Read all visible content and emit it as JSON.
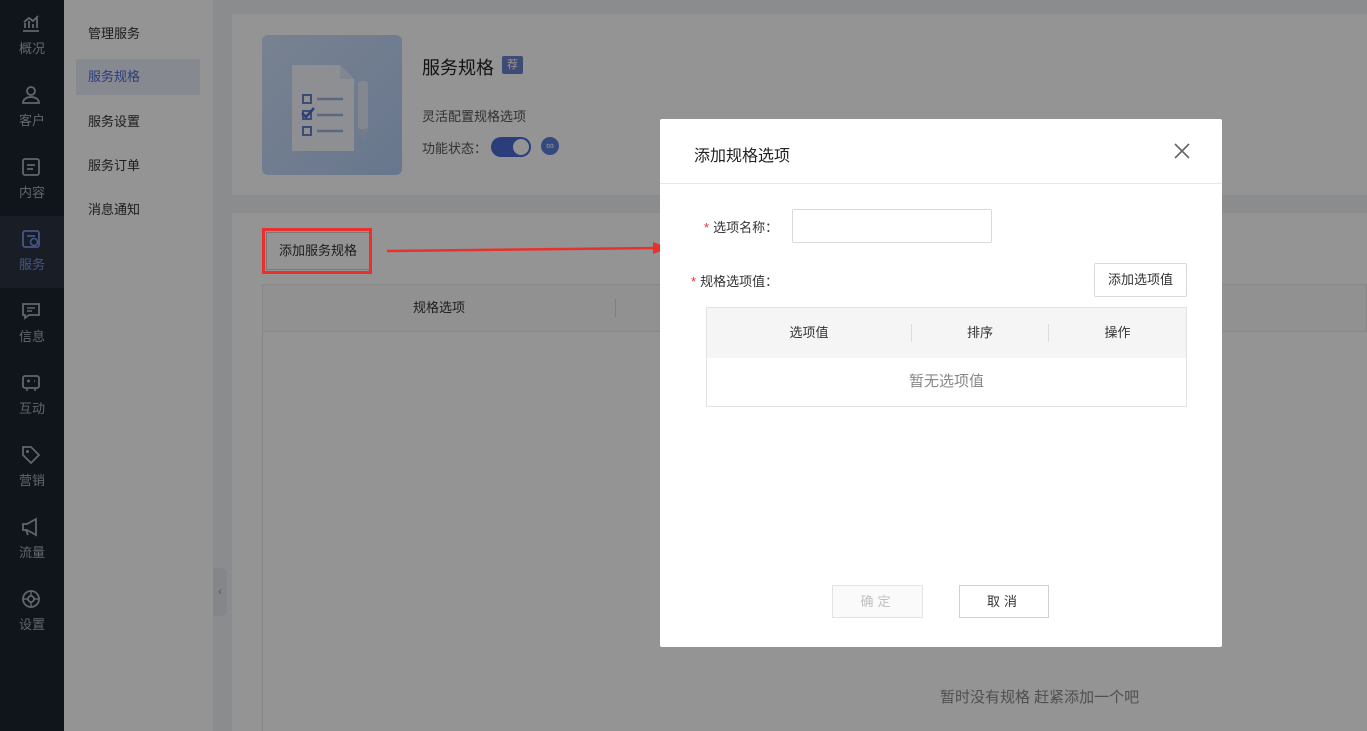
{
  "leftnav": {
    "items": [
      {
        "label": "概况",
        "icon": "chart-icon"
      },
      {
        "label": "客户",
        "icon": "user-icon"
      },
      {
        "label": "内容",
        "icon": "document-icon"
      },
      {
        "label": "服务",
        "icon": "service-icon",
        "active": true
      },
      {
        "label": "信息",
        "icon": "message-icon"
      },
      {
        "label": "互动",
        "icon": "interaction-icon"
      },
      {
        "label": "营销",
        "icon": "tag-icon"
      },
      {
        "label": "流量",
        "icon": "megaphone-icon"
      },
      {
        "label": "设置",
        "icon": "settings-icon"
      }
    ]
  },
  "subnav": {
    "items": [
      {
        "label": "管理服务"
      },
      {
        "label": "服务规格",
        "active": true
      },
      {
        "label": "服务设置"
      },
      {
        "label": "服务订单"
      },
      {
        "label": "消息通知"
      }
    ]
  },
  "service": {
    "title": "服务规格",
    "badge": "荐",
    "description": "灵活配置规格选项",
    "status_label": "功能状态：",
    "status_on": true
  },
  "main": {
    "add_spec_button": "添加服务规格",
    "table_headers": [
      "规格选项"
    ],
    "empty_text": "暂时没有规格 赶紧添加一个吧"
  },
  "modal": {
    "title": "添加规格选项",
    "name_label": "选项名称：",
    "name_value": "",
    "name_placeholder": "",
    "values_label": "规格选项值：",
    "add_value_button": "添加选项值",
    "table_headers": [
      "选项值",
      "排序",
      "操作"
    ],
    "empty_text": "暂无选项值",
    "ok_button": "确定",
    "cancel_button": "取消"
  },
  "colors": {
    "accent": "#4a6ad4",
    "nav_bg": "#1c2430",
    "highlight": "#e8302d"
  }
}
